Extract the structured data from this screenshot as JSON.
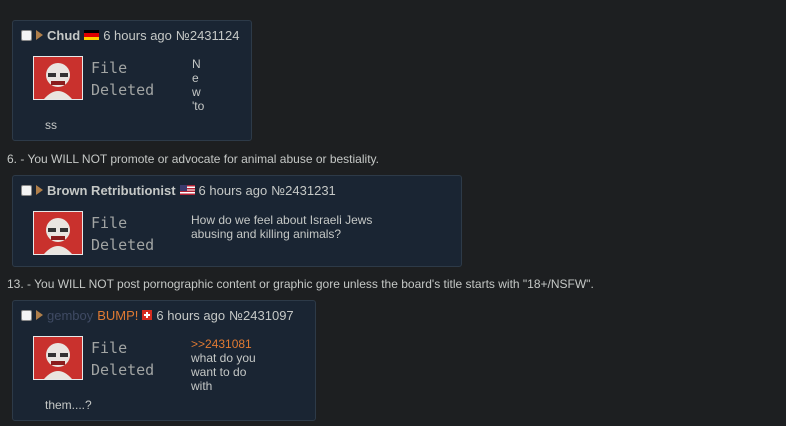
{
  "rules": {
    "rule6": "6. - You WILL NOT promote or advocate for animal abuse or bestiality.",
    "rule13": "13. - You WILL NOT post pornographic content or graphic gore unless the board's title starts with \"18+/NSFW\"."
  },
  "posts": [
    {
      "name": "Chud",
      "flag": "germany-flag",
      "time": "6 hours ago",
      "number": "№2431124",
      "file_label": "File\nDeleted",
      "message_lines": [
        "N",
        "e",
        "w",
        "'to"
      ],
      "tail": "ss"
    },
    {
      "name": "Brown Retributionist",
      "flag": "usa-flag",
      "time": "6 hours ago",
      "number": "№2431231",
      "file_label": "File\nDeleted",
      "message_lines": [
        "How do we feel about Israeli Jews",
        "abusing and killing animals?"
      ]
    },
    {
      "name": "gemboy",
      "tag": "BUMP!",
      "flag": "switzerland-flag",
      "time": "6 hours ago",
      "number": "№2431097",
      "file_label": "File\nDeleted",
      "quote": ">>2431081",
      "message_lines": [
        "what do you",
        "want to do",
        "with"
      ],
      "tail": "them....?"
    }
  ],
  "colors": {
    "background": "#1d1f21",
    "post_bg": "#1a2533",
    "quote": "#e07a33",
    "thumb_red": "#c9312d"
  }
}
